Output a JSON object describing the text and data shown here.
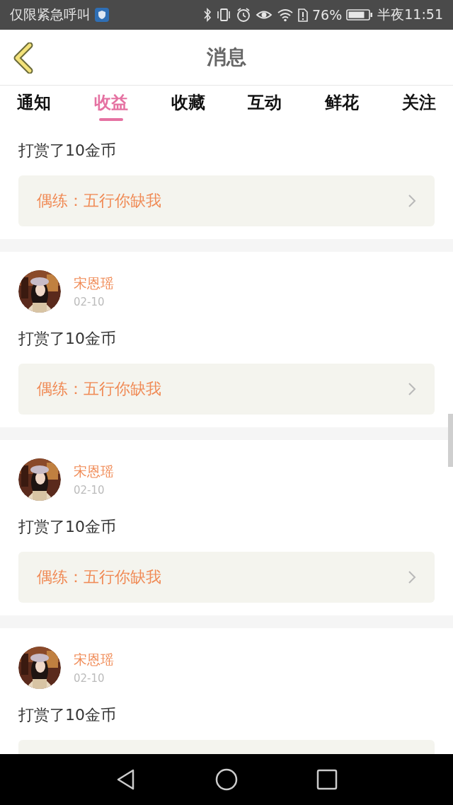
{
  "status_bar": {
    "carrier": "仅限紧急呼叫",
    "battery": "76%",
    "time": "半夜11:51"
  },
  "header": {
    "title": "消息"
  },
  "tabs": [
    {
      "label": "通知",
      "selected": false
    },
    {
      "label": "收益",
      "selected": true
    },
    {
      "label": "收藏",
      "selected": false
    },
    {
      "label": "互动",
      "selected": false
    },
    {
      "label": "鲜花",
      "selected": false
    },
    {
      "label": "关注",
      "selected": false
    }
  ],
  "messages": [
    {
      "message": "打赏了10金币",
      "link": "偶练：五行你缺我"
    },
    {
      "name": "宋恩瑶",
      "date": "02-10",
      "message": "打赏了10金币",
      "link": "偶练：五行你缺我"
    },
    {
      "name": "宋恩瑶",
      "date": "02-10",
      "message": "打赏了10金币",
      "link": "偶练：五行你缺我"
    },
    {
      "name": "宋恩瑶",
      "date": "02-10",
      "message": "打赏了10金币"
    }
  ]
}
